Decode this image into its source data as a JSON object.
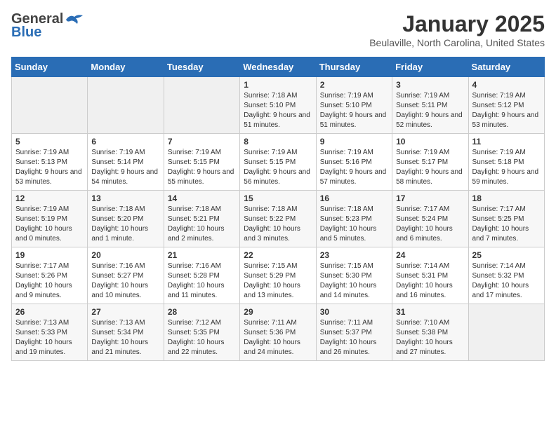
{
  "header": {
    "logo_general": "General",
    "logo_blue": "Blue",
    "month_title": "January 2025",
    "location": "Beulaville, North Carolina, United States"
  },
  "calendar": {
    "days_of_week": [
      "Sunday",
      "Monday",
      "Tuesday",
      "Wednesday",
      "Thursday",
      "Friday",
      "Saturday"
    ],
    "weeks": [
      [
        {
          "day": "",
          "info": ""
        },
        {
          "day": "",
          "info": ""
        },
        {
          "day": "",
          "info": ""
        },
        {
          "day": "1",
          "info": "Sunrise: 7:18 AM\nSunset: 5:10 PM\nDaylight: 9 hours and 51 minutes."
        },
        {
          "day": "2",
          "info": "Sunrise: 7:19 AM\nSunset: 5:10 PM\nDaylight: 9 hours and 51 minutes."
        },
        {
          "day": "3",
          "info": "Sunrise: 7:19 AM\nSunset: 5:11 PM\nDaylight: 9 hours and 52 minutes."
        },
        {
          "day": "4",
          "info": "Sunrise: 7:19 AM\nSunset: 5:12 PM\nDaylight: 9 hours and 53 minutes."
        }
      ],
      [
        {
          "day": "5",
          "info": "Sunrise: 7:19 AM\nSunset: 5:13 PM\nDaylight: 9 hours and 53 minutes."
        },
        {
          "day": "6",
          "info": "Sunrise: 7:19 AM\nSunset: 5:14 PM\nDaylight: 9 hours and 54 minutes."
        },
        {
          "day": "7",
          "info": "Sunrise: 7:19 AM\nSunset: 5:15 PM\nDaylight: 9 hours and 55 minutes."
        },
        {
          "day": "8",
          "info": "Sunrise: 7:19 AM\nSunset: 5:15 PM\nDaylight: 9 hours and 56 minutes."
        },
        {
          "day": "9",
          "info": "Sunrise: 7:19 AM\nSunset: 5:16 PM\nDaylight: 9 hours and 57 minutes."
        },
        {
          "day": "10",
          "info": "Sunrise: 7:19 AM\nSunset: 5:17 PM\nDaylight: 9 hours and 58 minutes."
        },
        {
          "day": "11",
          "info": "Sunrise: 7:19 AM\nSunset: 5:18 PM\nDaylight: 9 hours and 59 minutes."
        }
      ],
      [
        {
          "day": "12",
          "info": "Sunrise: 7:19 AM\nSunset: 5:19 PM\nDaylight: 10 hours and 0 minutes."
        },
        {
          "day": "13",
          "info": "Sunrise: 7:18 AM\nSunset: 5:20 PM\nDaylight: 10 hours and 1 minute."
        },
        {
          "day": "14",
          "info": "Sunrise: 7:18 AM\nSunset: 5:21 PM\nDaylight: 10 hours and 2 minutes."
        },
        {
          "day": "15",
          "info": "Sunrise: 7:18 AM\nSunset: 5:22 PM\nDaylight: 10 hours and 3 minutes."
        },
        {
          "day": "16",
          "info": "Sunrise: 7:18 AM\nSunset: 5:23 PM\nDaylight: 10 hours and 5 minutes."
        },
        {
          "day": "17",
          "info": "Sunrise: 7:17 AM\nSunset: 5:24 PM\nDaylight: 10 hours and 6 minutes."
        },
        {
          "day": "18",
          "info": "Sunrise: 7:17 AM\nSunset: 5:25 PM\nDaylight: 10 hours and 7 minutes."
        }
      ],
      [
        {
          "day": "19",
          "info": "Sunrise: 7:17 AM\nSunset: 5:26 PM\nDaylight: 10 hours and 9 minutes."
        },
        {
          "day": "20",
          "info": "Sunrise: 7:16 AM\nSunset: 5:27 PM\nDaylight: 10 hours and 10 minutes."
        },
        {
          "day": "21",
          "info": "Sunrise: 7:16 AM\nSunset: 5:28 PM\nDaylight: 10 hours and 11 minutes."
        },
        {
          "day": "22",
          "info": "Sunrise: 7:15 AM\nSunset: 5:29 PM\nDaylight: 10 hours and 13 minutes."
        },
        {
          "day": "23",
          "info": "Sunrise: 7:15 AM\nSunset: 5:30 PM\nDaylight: 10 hours and 14 minutes."
        },
        {
          "day": "24",
          "info": "Sunrise: 7:14 AM\nSunset: 5:31 PM\nDaylight: 10 hours and 16 minutes."
        },
        {
          "day": "25",
          "info": "Sunrise: 7:14 AM\nSunset: 5:32 PM\nDaylight: 10 hours and 17 minutes."
        }
      ],
      [
        {
          "day": "26",
          "info": "Sunrise: 7:13 AM\nSunset: 5:33 PM\nDaylight: 10 hours and 19 minutes."
        },
        {
          "day": "27",
          "info": "Sunrise: 7:13 AM\nSunset: 5:34 PM\nDaylight: 10 hours and 21 minutes."
        },
        {
          "day": "28",
          "info": "Sunrise: 7:12 AM\nSunset: 5:35 PM\nDaylight: 10 hours and 22 minutes."
        },
        {
          "day": "29",
          "info": "Sunrise: 7:11 AM\nSunset: 5:36 PM\nDaylight: 10 hours and 24 minutes."
        },
        {
          "day": "30",
          "info": "Sunrise: 7:11 AM\nSunset: 5:37 PM\nDaylight: 10 hours and 26 minutes."
        },
        {
          "day": "31",
          "info": "Sunrise: 7:10 AM\nSunset: 5:38 PM\nDaylight: 10 hours and 27 minutes."
        },
        {
          "day": "",
          "info": ""
        }
      ]
    ]
  }
}
